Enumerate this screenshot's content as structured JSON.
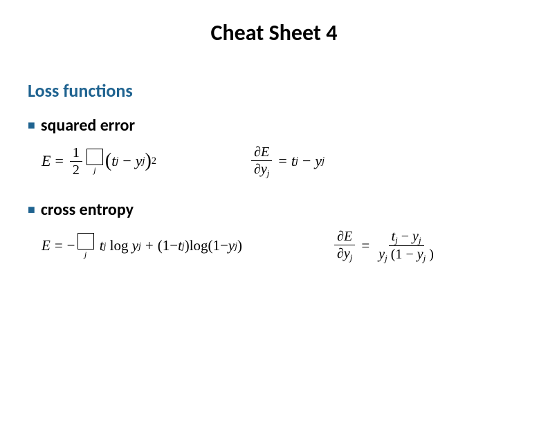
{
  "title": "Cheat Sheet 4",
  "section": "Loss functions",
  "bullets": {
    "squared": "squared error",
    "cross_entropy": "cross entropy"
  },
  "formulas": {
    "squared_error": {
      "lhs_E": "E",
      "eq": "=",
      "frac_num": "1",
      "frac_den": "2",
      "sum_sub": "j",
      "term_open": "(",
      "term_t": "t",
      "term_t_sub": "j",
      "minus": "−",
      "term_y": "y",
      "term_y_sub": "j",
      "term_close": ")",
      "exp": "2"
    },
    "squared_error_deriv": {
      "partial": "∂",
      "E": "E",
      "y": "y",
      "y_sub": "j",
      "eq": "=",
      "t": "t",
      "t_sub": "j",
      "minus": "−",
      "y2": "y",
      "y2_sub": "j"
    },
    "cross_entropy": {
      "E": "E",
      "eq": "=",
      "neg": "−",
      "sum_sub": "j",
      "t": "t",
      "t_sub": "j",
      "log1": "log",
      "y": "y",
      "y_sub": "j",
      "plus": "+",
      "open": "(1",
      "minus1": "−",
      "t2": "t",
      "t2_sub": "j",
      "close": ")",
      "log2": "log(1",
      "minus2": "−",
      "y2": "y",
      "y2_sub": "j",
      "close2": ")"
    },
    "cross_entropy_deriv": {
      "partial": "∂",
      "E": "E",
      "y": "y",
      "y_sub": "j",
      "eq": "=",
      "num_t": "t",
      "num_t_sub": "j",
      "num_minus": "−",
      "num_y": "y",
      "num_y_sub": "j",
      "den_y": "y",
      "den_y_sub": "j",
      "den_open": "(1",
      "den_minus": "−",
      "den_y2": "y",
      "den_y2_sub": "j",
      "den_close": ")"
    }
  }
}
